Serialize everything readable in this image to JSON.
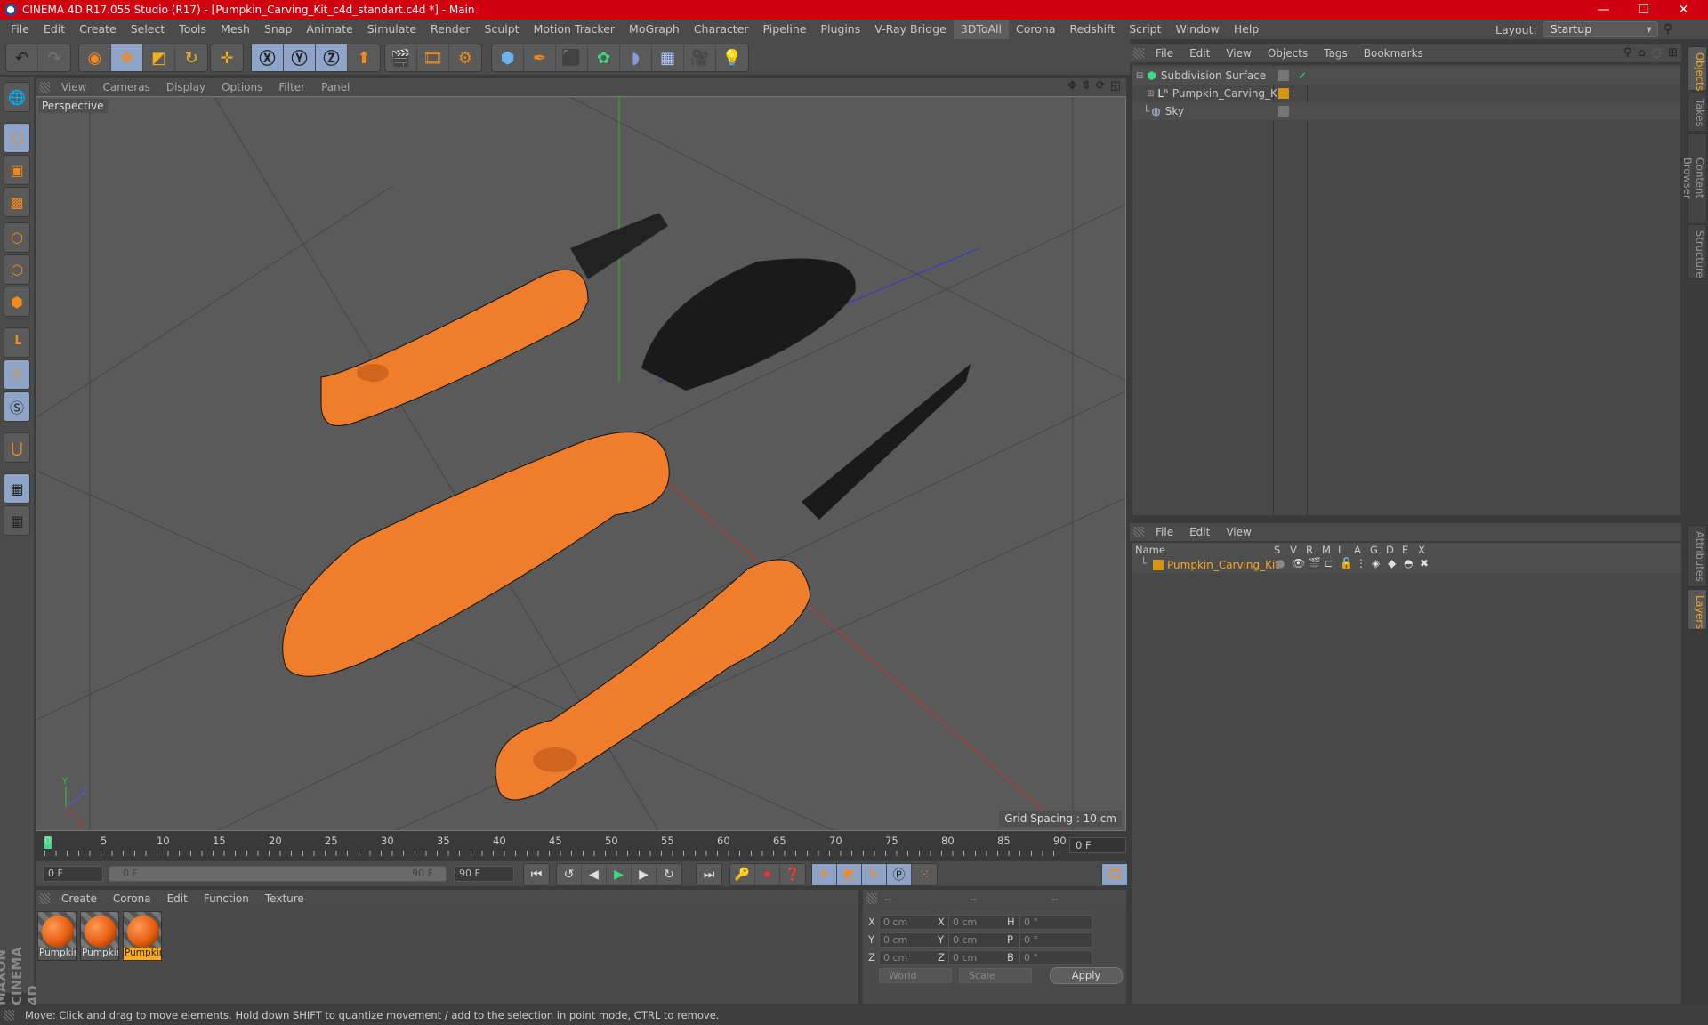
{
  "window": {
    "title": "CINEMA 4D R17.055 Studio (R17) - [Pumpkin_Carving_Kit_c4d_standart.c4d *] - Main",
    "minimize": "—",
    "maximize": "❐",
    "close": "✕"
  },
  "menubar": {
    "items": [
      "File",
      "Edit",
      "Create",
      "Select",
      "Tools",
      "Mesh",
      "Snap",
      "Animate",
      "Simulate",
      "Render",
      "Sculpt",
      "Motion Tracker",
      "MoGraph",
      "Character",
      "Pipeline",
      "Plugins",
      "V-Ray Bridge",
      "3DToAll",
      "Corona",
      "Redshift",
      "Script",
      "Window",
      "Help"
    ],
    "active": "3DToAll",
    "layout_label": "Layout:",
    "layout_value": "Startup"
  },
  "toolbar": {
    "undo": "undo-icon",
    "redo": "redo-icon",
    "tools": [
      "select",
      "move",
      "scale",
      "rotate",
      "live-move"
    ],
    "axes": [
      "X",
      "Y",
      "Z"
    ],
    "coord_system": "coord-system-icon",
    "render": [
      "render-view",
      "render-picture-viewer",
      "render-settings"
    ],
    "create": [
      "cube",
      "pen",
      "subdivision",
      "cloner",
      "deformer",
      "floor",
      "camera",
      "light"
    ]
  },
  "left_tools": [
    "model-mode",
    "texture-mode",
    "workplane",
    "points-mode",
    "edges-mode",
    "polygons-mode",
    "axis-mode",
    "tweak-mode",
    "snap-solo",
    "magnet",
    "lock-workplane",
    "planar-workplane"
  ],
  "viewport": {
    "menu": [
      "View",
      "Cameras",
      "Display",
      "Options",
      "Filter",
      "Panel"
    ],
    "label": "Perspective",
    "grid_spacing": "Grid Spacing : 10 cm",
    "axis_labels": {
      "x": "X",
      "y": "Y",
      "z": "Z"
    }
  },
  "timeline": {
    "ticks": [
      "0",
      "5",
      "10",
      "15",
      "20",
      "25",
      "30",
      "35",
      "40",
      "45",
      "50",
      "55",
      "60",
      "65",
      "70",
      "75",
      "80",
      "85",
      "90"
    ],
    "current_frame_display": "0 F",
    "start_field": "0 F",
    "range_start": "0 F",
    "range_end": "90 F",
    "end_field": "90 F"
  },
  "materials": {
    "menu": [
      "Create",
      "Corona",
      "Edit",
      "Function",
      "Texture"
    ],
    "items": [
      {
        "name": "Pumpkin",
        "selected": false
      },
      {
        "name": "Pumpkin",
        "selected": false
      },
      {
        "name": "Pumpkin",
        "selected": true
      }
    ]
  },
  "coordinates": {
    "headers": [
      "--",
      "--",
      "--"
    ],
    "rows": [
      {
        "a": "X",
        "av": "0 cm",
        "b": "X",
        "bv": "0 cm",
        "c": "H",
        "cv": "0 °"
      },
      {
        "a": "Y",
        "av": "0 cm",
        "b": "Y",
        "bv": "0 cm",
        "c": "P",
        "cv": "0 °"
      },
      {
        "a": "Z",
        "av": "0 cm",
        "b": "Z",
        "bv": "0 cm",
        "c": "B",
        "cv": "0 °"
      }
    ],
    "space": "World",
    "mode": "Scale",
    "apply": "Apply"
  },
  "object_manager": {
    "menu": [
      "File",
      "Edit",
      "View",
      "Objects",
      "Tags",
      "Bookmarks"
    ],
    "objects": [
      {
        "name": "Subdivision Surface",
        "icon": "subdivision-icon",
        "checked": true
      },
      {
        "name": "Pumpkin_Carving_Kit",
        "icon": "null-icon",
        "color": "#d4960f"
      },
      {
        "name": "Sky",
        "icon": "sky-icon"
      }
    ]
  },
  "layer_manager": {
    "menu": [
      "File",
      "Edit",
      "View"
    ],
    "columns": [
      "Name",
      "S",
      "V",
      "R",
      "M",
      "L",
      "A",
      "G",
      "D",
      "E",
      "X"
    ],
    "layers": [
      {
        "name": "Pumpkin_Carving_Kit",
        "color": "#d4960f"
      }
    ]
  },
  "side_tabs": {
    "top": [
      "Objects",
      "Takes",
      "Content Browser",
      "Structure"
    ],
    "bottom": [
      "Attributes",
      "Layers"
    ]
  },
  "status": "Move: Click and drag to move elements. Hold down SHIFT to quantize movement / add to the selection in point mode, CTRL to remove.",
  "branding": "MAXON CINEMA 4D",
  "colors": {
    "accent": "#f38a1d",
    "titlebar": "#d0000f",
    "selection": "#8ea5c9",
    "layer": "#f5a623"
  }
}
